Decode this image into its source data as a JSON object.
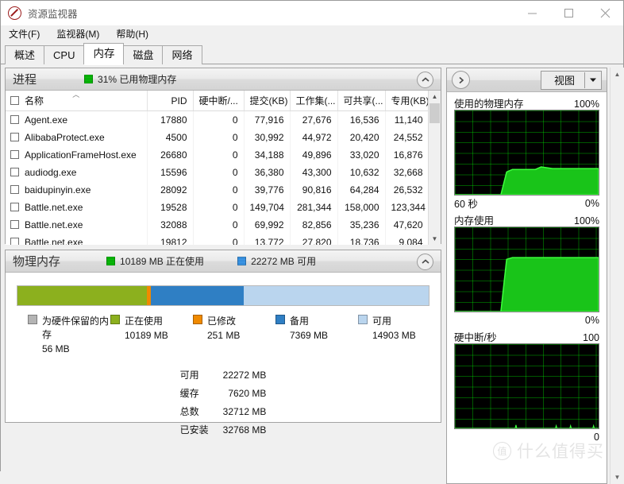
{
  "window": {
    "title": "资源监视器",
    "icon": "resource-monitor-icon",
    "minimize_label": "–",
    "maximize_label": "□",
    "close_label": "✕"
  },
  "menu": [
    {
      "label": "文件(F)"
    },
    {
      "label": "监视器(M)"
    },
    {
      "label": "帮助(H)"
    }
  ],
  "tabs": [
    {
      "label": "概述",
      "active": false
    },
    {
      "label": "CPU",
      "active": false
    },
    {
      "label": "内存",
      "active": true
    },
    {
      "label": "磁盘",
      "active": false
    },
    {
      "label": "网络",
      "active": false
    }
  ],
  "processes": {
    "title": "进程",
    "status": "31% 已用物理内存",
    "columns": [
      "名称",
      "PID",
      "硬中断/...",
      "提交(KB)",
      "工作集(...",
      "可共享(...",
      "专用(KB)"
    ],
    "rows": [
      {
        "name": "Agent.exe",
        "pid": "17880",
        "hard_faults": "0",
        "commit": "77,916",
        "working_set": "27,676",
        "shareable": "16,536",
        "private": "11,140"
      },
      {
        "name": "AlibabaProtect.exe",
        "pid": "4500",
        "hard_faults": "0",
        "commit": "30,992",
        "working_set": "44,972",
        "shareable": "20,420",
        "private": "24,552"
      },
      {
        "name": "ApplicationFrameHost.exe",
        "pid": "26680",
        "hard_faults": "0",
        "commit": "34,188",
        "working_set": "49,896",
        "shareable": "33,020",
        "private": "16,876"
      },
      {
        "name": "audiodg.exe",
        "pid": "15596",
        "hard_faults": "0",
        "commit": "36,380",
        "working_set": "43,300",
        "shareable": "10,632",
        "private": "32,668"
      },
      {
        "name": "baidupinyin.exe",
        "pid": "28092",
        "hard_faults": "0",
        "commit": "39,776",
        "working_set": "90,816",
        "shareable": "64,284",
        "private": "26,532"
      },
      {
        "name": "Battle.net.exe",
        "pid": "19528",
        "hard_faults": "0",
        "commit": "149,704",
        "working_set": "281,344",
        "shareable": "158,000",
        "private": "123,344"
      },
      {
        "name": "Battle.net.exe",
        "pid": "32088",
        "hard_faults": "0",
        "commit": "69,992",
        "working_set": "82,856",
        "shareable": "35,236",
        "private": "47,620"
      },
      {
        "name": "Battle.net.exe",
        "pid": "19812",
        "hard_faults": "0",
        "commit": "13,772",
        "working_set": "27,820",
        "shareable": "18,736",
        "private": "9,084"
      }
    ]
  },
  "physical_memory": {
    "title": "物理内存",
    "stat_in_use": "10189 MB 正在使用",
    "stat_available": "22272 MB 可用",
    "legend": [
      {
        "label": "为硬件保留的内存",
        "value": "56 MB",
        "color": "#b4b4b4"
      },
      {
        "label": "正在使用",
        "value": "10189 MB",
        "color": "#8cb01e"
      },
      {
        "label": "已修改",
        "value": "251 MB",
        "color": "#f08a00"
      },
      {
        "label": "备用",
        "value": "7369 MB",
        "color": "#2f7fc4"
      },
      {
        "label": "可用",
        "value": "14903 MB",
        "color": "#bad5ee"
      }
    ],
    "summary": [
      {
        "key": "可用",
        "value": "22272 MB"
      },
      {
        "key": "缓存",
        "value": "7620 MB"
      },
      {
        "key": "总数",
        "value": "32712 MB"
      },
      {
        "key": "已安装",
        "value": "32768 MB"
      }
    ]
  },
  "graph_panel": {
    "expand_icon": "chevron-right-icon",
    "view_label": "视图",
    "view_arrow_icon": "chevron-down-icon"
  },
  "chart_data": [
    {
      "type": "area",
      "title": "使用的物理内存",
      "ymax_label": "100%",
      "ymin_label": "0%",
      "xlabel": "60 秒",
      "ylim": [
        0,
        100
      ],
      "grid": true,
      "series": [
        {
          "name": "使用的物理内存",
          "x": [
            0,
            28,
            32,
            36,
            40,
            52,
            56,
            60,
            68,
            74,
            80,
            88,
            100
          ],
          "values": [
            0,
            0,
            0,
            27,
            30,
            30,
            30,
            33,
            31,
            31,
            31,
            31,
            31
          ]
        }
      ]
    },
    {
      "type": "area",
      "title": "内存使用",
      "ymax_label": "100%",
      "ymin_label": "0%",
      "ylim": [
        0,
        100
      ],
      "grid": true,
      "series": [
        {
          "name": "内存使用",
          "x": [
            0,
            28,
            32,
            36,
            40,
            60,
            80,
            100
          ],
          "values": [
            0,
            0,
            0,
            62,
            64,
            64,
            64,
            64
          ]
        }
      ]
    },
    {
      "type": "line",
      "title": "硬中断/秒",
      "ymax_label": "100",
      "ymin_label": "0",
      "ylim": [
        0,
        100
      ],
      "grid": true,
      "series": [
        {
          "name": "硬中断/秒",
          "x": [
            0,
            42,
            42.5,
            43,
            70,
            70.5,
            71,
            80,
            80.5,
            81,
            96,
            96.5,
            97,
            100
          ],
          "values": [
            0,
            0,
            3,
            0,
            0,
            2,
            0,
            0,
            2,
            0,
            0,
            2,
            0,
            0
          ]
        }
      ]
    }
  ],
  "watermark": {
    "badge": "值",
    "text": "什么值得买"
  }
}
